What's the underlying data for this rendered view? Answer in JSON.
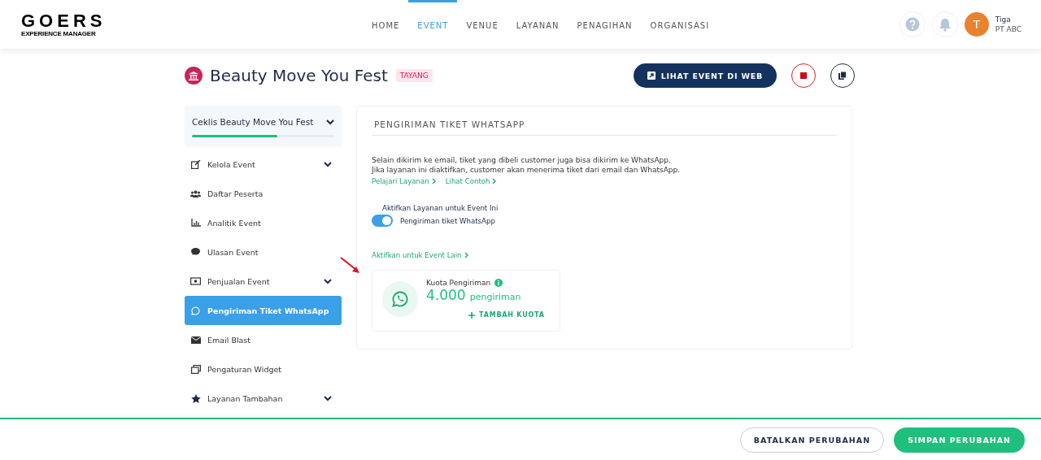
{
  "header": {
    "logo": "GOERS",
    "logo_sub": "EXPERIENCE MANAGER",
    "nav": [
      {
        "label": "HOME",
        "selected": false
      },
      {
        "label": "EVENT",
        "selected": true
      },
      {
        "label": "VENUE",
        "selected": false
      },
      {
        "label": "LAYANAN",
        "selected": false
      },
      {
        "label": "PENAGIHAN",
        "selected": false
      },
      {
        "label": "ORGANISASI",
        "selected": false
      }
    ],
    "user": {
      "initial": "T",
      "name": "Tiga",
      "org": "PT ABC"
    }
  },
  "event": {
    "title": "Beauty Move You Fest",
    "status": "TAYANG",
    "view_button": "LIHAT EVENT DI WEB"
  },
  "sidebar": {
    "checklist": {
      "label": "Ceklis Beauty Move You Fest",
      "level": 0.6
    },
    "items": [
      {
        "label": "Kelola Event",
        "selected": false,
        "has_submenu": true
      },
      {
        "label": "Daftar Peserta",
        "selected": false,
        "has_submenu": false
      },
      {
        "label": "Analitik Event",
        "selected": false,
        "has_submenu": false
      },
      {
        "label": "Ulasan Event",
        "selected": false,
        "has_submenu": false
      },
      {
        "label": "Penjualan Event",
        "selected": false,
        "has_submenu": true
      },
      {
        "label": "Pengiriman Tiket WhatsApp",
        "selected": true,
        "has_submenu": false
      },
      {
        "label": "Email Blast",
        "selected": false,
        "has_submenu": false
      },
      {
        "label": "Pengaturan Widget",
        "selected": false,
        "has_submenu": false
      },
      {
        "label": "Layanan Tambahan",
        "selected": false,
        "has_submenu": true
      }
    ]
  },
  "panel": {
    "title": "PENGIRIMAN TIKET WHATSAPP",
    "description": "Selain dikirim ke email, tiket yang dibeli customer juga bisa dikirim ke WhatsApp. Jika layanan ini diaktifkan, customer akan menerima tiket dari email dan WhatsApp.",
    "links": [
      "Pelajari Layanan",
      "Lihat Contoh"
    ],
    "toggle_heading": "Aktifkan Layanan untuk Event Ini",
    "toggle": {
      "label": "Pengiriman tiket WhatsApp",
      "on": true
    },
    "other_link": "Aktifkan untuk Event Lain",
    "quota": {
      "label": "Kuota Pengiriman",
      "value": "4.000",
      "unit": "pengiriman",
      "add_button": "TAMBAH KUOTA"
    }
  },
  "footer": {
    "cancel": "BATALKAN PERUBAHAN",
    "save": "SIMPAN PERUBAHAN"
  }
}
